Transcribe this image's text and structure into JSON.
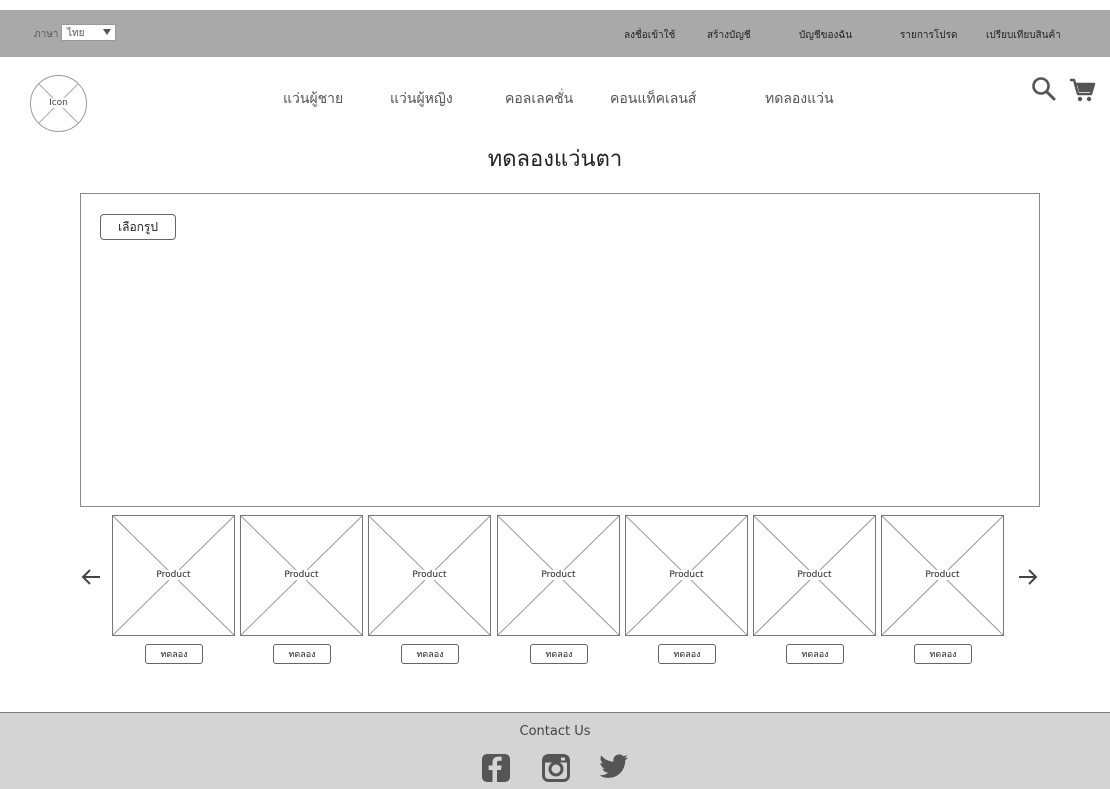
{
  "topbar": {
    "language_label": "ภาษา",
    "language_value": "ไทย",
    "links": [
      "ลงชื่อเข้าใช้",
      "สร้างบัญชี",
      "บัญชีของฉัน",
      "รายการโปรด",
      "เปรียบเทียบสินค้า"
    ]
  },
  "header": {
    "logo_text": "Icon",
    "nav": [
      "แว่นผู้ชาย",
      "แว่นผู้หญิง",
      "คอลเลคชั่น",
      "คอนแท็คเลนส์",
      "ทดลองแว่น"
    ]
  },
  "page_title": "ทดลองแว่นตา",
  "tryon": {
    "choose_button": "เลือกรูป"
  },
  "products": [
    {
      "label": "Product",
      "button": "ทดลอง"
    },
    {
      "label": "Product",
      "button": "ทดลอง"
    },
    {
      "label": "Product",
      "button": "ทดลอง"
    },
    {
      "label": "Product",
      "button": "ทดลอง"
    },
    {
      "label": "Product",
      "button": "ทดลอง"
    },
    {
      "label": "Product",
      "button": "ทดลอง"
    },
    {
      "label": "Product",
      "button": "ทดลอง"
    }
  ],
  "footer": {
    "contact_title": "Contact Us"
  },
  "icons": [
    "search-icon",
    "cart-icon",
    "arrow-left-icon",
    "arrow-right-icon",
    "facebook-icon",
    "instagram-icon",
    "twitter-icon"
  ],
  "colors": {
    "topbar_bg": "#a9a9a9",
    "footer_bg": "#d4d4d4",
    "icon_color": "#555555"
  }
}
